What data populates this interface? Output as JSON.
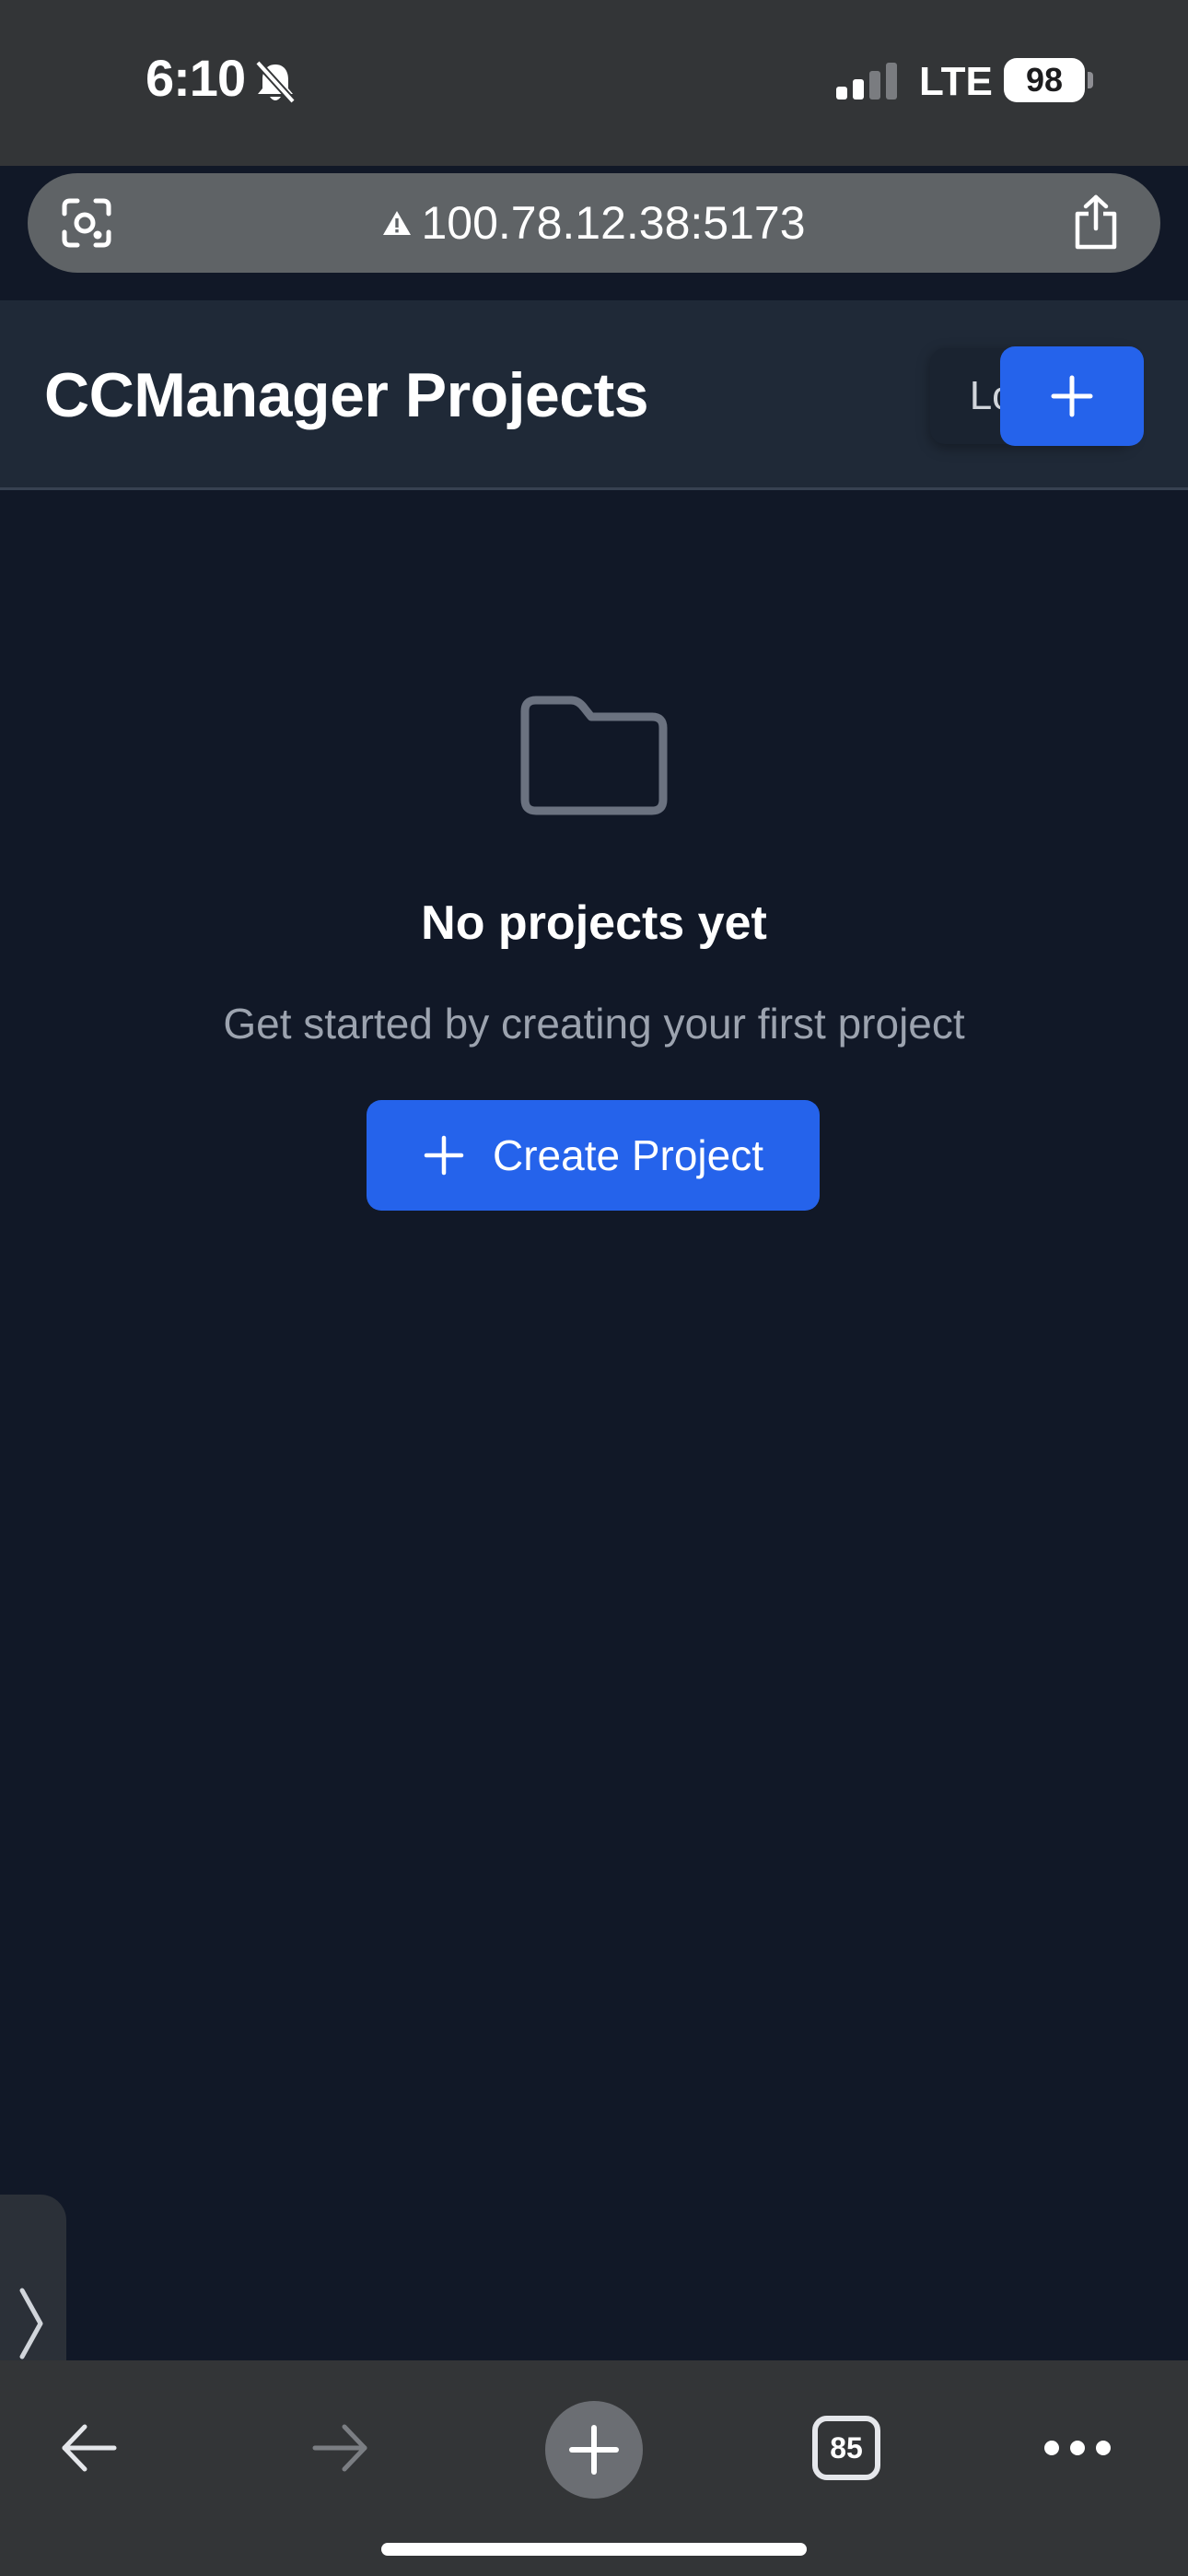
{
  "status_bar": {
    "time": "6:10",
    "network": "LTE",
    "battery": "98",
    "icons": [
      "bell-slash-icon",
      "signal-bars-icon"
    ]
  },
  "browser": {
    "url": "100.78.12.38:5173",
    "icons": [
      "lens-icon",
      "not-secure-warning-icon",
      "share-icon"
    ],
    "toolbar": {
      "tab_count": "85",
      "icons": [
        "back-arrow-icon",
        "forward-arrow-icon",
        "new-tab-plus-icon",
        "tab-switcher-icon",
        "more-dots-icon"
      ]
    }
  },
  "header": {
    "title": "CCManager Projects",
    "logout_label": "Logout",
    "add_icon": "plus-icon"
  },
  "empty_state": {
    "icon": "folder-icon",
    "title": "No projects yet",
    "subtitle": "Get started by creating your first project",
    "button_label": "Create Project"
  },
  "colors": {
    "accent": "#2563eb",
    "page_background": "#111827",
    "header_background": "#1f2937",
    "browser_chrome": "#333537"
  }
}
